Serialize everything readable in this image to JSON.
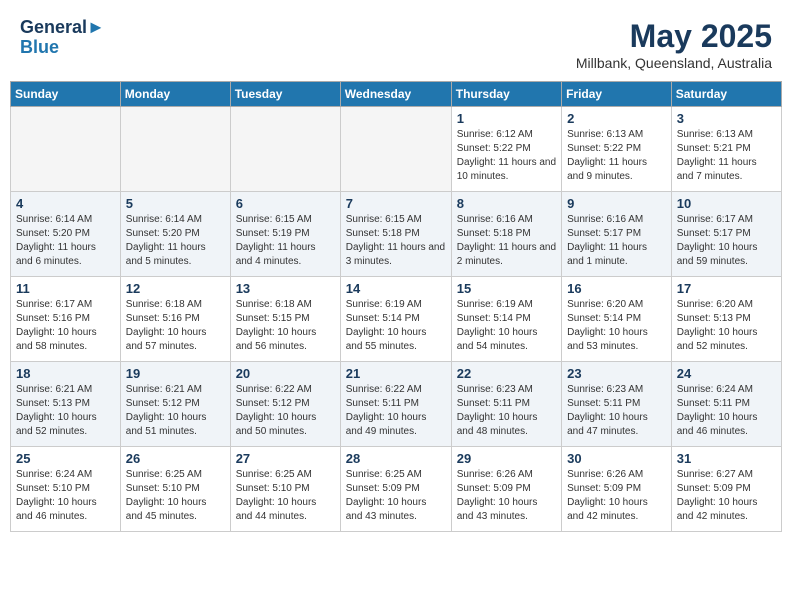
{
  "header": {
    "logo_line1": "General",
    "logo_line2": "Blue",
    "month": "May 2025",
    "location": "Millbank, Queensland, Australia"
  },
  "weekdays": [
    "Sunday",
    "Monday",
    "Tuesday",
    "Wednesday",
    "Thursday",
    "Friday",
    "Saturday"
  ],
  "weeks": [
    [
      {
        "day": "",
        "empty": true
      },
      {
        "day": "",
        "empty": true
      },
      {
        "day": "",
        "empty": true
      },
      {
        "day": "",
        "empty": true
      },
      {
        "day": "1",
        "sunrise": "6:12 AM",
        "sunset": "5:22 PM",
        "daylight": "11 hours and 10 minutes."
      },
      {
        "day": "2",
        "sunrise": "6:13 AM",
        "sunset": "5:22 PM",
        "daylight": "11 hours and 9 minutes."
      },
      {
        "day": "3",
        "sunrise": "6:13 AM",
        "sunset": "5:21 PM",
        "daylight": "11 hours and 7 minutes."
      }
    ],
    [
      {
        "day": "4",
        "sunrise": "6:14 AM",
        "sunset": "5:20 PM",
        "daylight": "11 hours and 6 minutes."
      },
      {
        "day": "5",
        "sunrise": "6:14 AM",
        "sunset": "5:20 PM",
        "daylight": "11 hours and 5 minutes."
      },
      {
        "day": "6",
        "sunrise": "6:15 AM",
        "sunset": "5:19 PM",
        "daylight": "11 hours and 4 minutes."
      },
      {
        "day": "7",
        "sunrise": "6:15 AM",
        "sunset": "5:18 PM",
        "daylight": "11 hours and 3 minutes."
      },
      {
        "day": "8",
        "sunrise": "6:16 AM",
        "sunset": "5:18 PM",
        "daylight": "11 hours and 2 minutes."
      },
      {
        "day": "9",
        "sunrise": "6:16 AM",
        "sunset": "5:17 PM",
        "daylight": "11 hours and 1 minute."
      },
      {
        "day": "10",
        "sunrise": "6:17 AM",
        "sunset": "5:17 PM",
        "daylight": "10 hours and 59 minutes."
      }
    ],
    [
      {
        "day": "11",
        "sunrise": "6:17 AM",
        "sunset": "5:16 PM",
        "daylight": "10 hours and 58 minutes."
      },
      {
        "day": "12",
        "sunrise": "6:18 AM",
        "sunset": "5:16 PM",
        "daylight": "10 hours and 57 minutes."
      },
      {
        "day": "13",
        "sunrise": "6:18 AM",
        "sunset": "5:15 PM",
        "daylight": "10 hours and 56 minutes."
      },
      {
        "day": "14",
        "sunrise": "6:19 AM",
        "sunset": "5:14 PM",
        "daylight": "10 hours and 55 minutes."
      },
      {
        "day": "15",
        "sunrise": "6:19 AM",
        "sunset": "5:14 PM",
        "daylight": "10 hours and 54 minutes."
      },
      {
        "day": "16",
        "sunrise": "6:20 AM",
        "sunset": "5:14 PM",
        "daylight": "10 hours and 53 minutes."
      },
      {
        "day": "17",
        "sunrise": "6:20 AM",
        "sunset": "5:13 PM",
        "daylight": "10 hours and 52 minutes."
      }
    ],
    [
      {
        "day": "18",
        "sunrise": "6:21 AM",
        "sunset": "5:13 PM",
        "daylight": "10 hours and 52 minutes."
      },
      {
        "day": "19",
        "sunrise": "6:21 AM",
        "sunset": "5:12 PM",
        "daylight": "10 hours and 51 minutes."
      },
      {
        "day": "20",
        "sunrise": "6:22 AM",
        "sunset": "5:12 PM",
        "daylight": "10 hours and 50 minutes."
      },
      {
        "day": "21",
        "sunrise": "6:22 AM",
        "sunset": "5:11 PM",
        "daylight": "10 hours and 49 minutes."
      },
      {
        "day": "22",
        "sunrise": "6:23 AM",
        "sunset": "5:11 PM",
        "daylight": "10 hours and 48 minutes."
      },
      {
        "day": "23",
        "sunrise": "6:23 AM",
        "sunset": "5:11 PM",
        "daylight": "10 hours and 47 minutes."
      },
      {
        "day": "24",
        "sunrise": "6:24 AM",
        "sunset": "5:11 PM",
        "daylight": "10 hours and 46 minutes."
      }
    ],
    [
      {
        "day": "25",
        "sunrise": "6:24 AM",
        "sunset": "5:10 PM",
        "daylight": "10 hours and 46 minutes."
      },
      {
        "day": "26",
        "sunrise": "6:25 AM",
        "sunset": "5:10 PM",
        "daylight": "10 hours and 45 minutes."
      },
      {
        "day": "27",
        "sunrise": "6:25 AM",
        "sunset": "5:10 PM",
        "daylight": "10 hours and 44 minutes."
      },
      {
        "day": "28",
        "sunrise": "6:25 AM",
        "sunset": "5:09 PM",
        "daylight": "10 hours and 43 minutes."
      },
      {
        "day": "29",
        "sunrise": "6:26 AM",
        "sunset": "5:09 PM",
        "daylight": "10 hours and 43 minutes."
      },
      {
        "day": "30",
        "sunrise": "6:26 AM",
        "sunset": "5:09 PM",
        "daylight": "10 hours and 42 minutes."
      },
      {
        "day": "31",
        "sunrise": "6:27 AM",
        "sunset": "5:09 PM",
        "daylight": "10 hours and 42 minutes."
      }
    ]
  ],
  "labels": {
    "sunrise_prefix": "Sunrise: ",
    "sunset_prefix": "Sunset: ",
    "daylight_prefix": "Daylight: "
  }
}
